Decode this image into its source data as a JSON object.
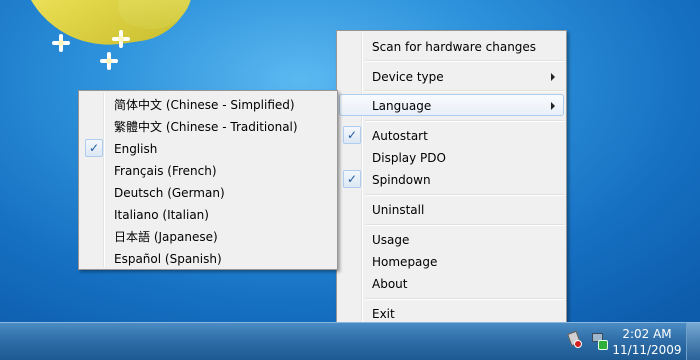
{
  "main_menu": {
    "items": [
      {
        "label": "Scan for hardware changes",
        "checked": false,
        "submenu": false
      },
      {
        "label": "Device type",
        "checked": false,
        "submenu": true
      },
      {
        "label": "Language",
        "checked": false,
        "submenu": true,
        "highlighted": true
      },
      {
        "label": "Autostart",
        "checked": true,
        "submenu": false
      },
      {
        "label": "Display PDO",
        "checked": false,
        "submenu": false
      },
      {
        "label": "Spindown",
        "checked": true,
        "submenu": false
      },
      {
        "label": "Uninstall",
        "checked": false,
        "submenu": false
      },
      {
        "label": "Usage",
        "checked": false,
        "submenu": false
      },
      {
        "label": "Homepage",
        "checked": false,
        "submenu": false
      },
      {
        "label": "About",
        "checked": false,
        "submenu": false
      },
      {
        "label": "Exit",
        "checked": false,
        "submenu": false
      }
    ]
  },
  "language_menu": {
    "items": [
      {
        "label": "简体中文 (Chinese - Simplified)",
        "checked": false
      },
      {
        "label": "繁體中文 (Chinese - Traditional)",
        "checked": false
      },
      {
        "label": "English",
        "checked": true
      },
      {
        "label": "Français (French)",
        "checked": false
      },
      {
        "label": "Deutsch (German)",
        "checked": false
      },
      {
        "label": "Italiano (Italian)",
        "checked": false
      },
      {
        "label": "日本語 (Japanese)",
        "checked": false
      },
      {
        "label": "Español (Spanish)",
        "checked": false
      }
    ]
  },
  "taskbar": {
    "time": "2:02 AM",
    "date": "11/11/2009",
    "tray_icons": [
      "usb-eject-icon",
      "network-icon"
    ]
  },
  "check_glyph": "✓",
  "colors": {
    "menu_bg": "#f0f0f0",
    "highlight_border": "#aeccee",
    "taskbar": "#2f6ea8",
    "desktop": "#1f79c8"
  }
}
